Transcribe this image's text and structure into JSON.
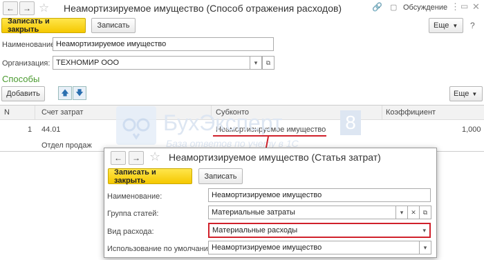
{
  "main": {
    "title": "Неамортизируемое имущество (Способ отражения расходов)",
    "discussion_label": "Обсуждение",
    "save_close_label": "Записать и закрыть",
    "save_label": "Записать",
    "more_label": "Еще",
    "name_label": "Наименование:",
    "name_value": "Неамортизируемое имущество",
    "org_label": "Организация:",
    "org_value": "ТЕХНОМИР ООО",
    "section_title": "Способы",
    "add_label": "Добавить",
    "more2_label": "Еще",
    "table": {
      "headers": [
        "N",
        "Счет затрат",
        "Субконто",
        "Коэффициент"
      ],
      "rows": [
        {
          "n": "1",
          "account": "44.01",
          "subconto": "Неамортизируемое имущество",
          "sub2": "Отдел продаж",
          "coef": "1,000"
        }
      ]
    }
  },
  "watermark": {
    "brand": "БухЭксперт",
    "number": "8",
    "tagline": "База ответов по учету в 1С"
  },
  "popup": {
    "title": "Неамортизируемое имущество (Статья затрат)",
    "save_close_label": "Записать и закрыть",
    "save_label": "Записать",
    "name_label": "Наименование:",
    "name_value": "Неамортизируемое имущество",
    "group_label": "Группа статей:",
    "group_value": "Материальные затраты",
    "kind_label": "Вид расхода:",
    "kind_value": "Материальные расходы",
    "default_label": "Использование по умолчанию:",
    "default_value": "Неамортизируемое имущество"
  },
  "colors": {
    "accent_green": "#4a9a2f",
    "highlight_red": "#d0202a",
    "button_yellow": "#f5c800"
  }
}
